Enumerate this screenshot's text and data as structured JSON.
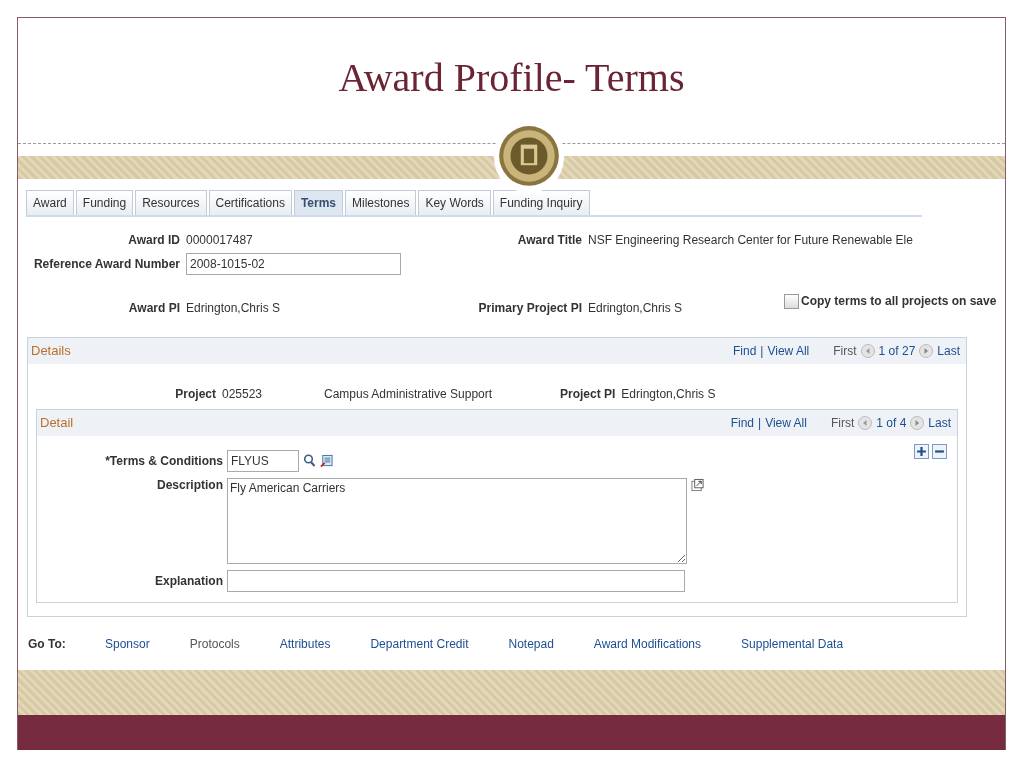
{
  "slide": {
    "title": "Award Profile- Terms"
  },
  "tabs": [
    {
      "label": "Award",
      "selected": false
    },
    {
      "label": "Funding",
      "selected": false
    },
    {
      "label": "Resources",
      "selected": false
    },
    {
      "label": "Certifications",
      "selected": false
    },
    {
      "label": "Terms",
      "selected": true
    },
    {
      "label": "Milestones",
      "selected": false
    },
    {
      "label": "Key Words",
      "selected": false
    },
    {
      "label": "Funding Inquiry",
      "selected": false
    }
  ],
  "award": {
    "award_id_label": "Award ID",
    "award_id": "0000017487",
    "award_title_label": "Award Title",
    "award_title": "NSF Engineering Research Center for Future Renewable Ele",
    "reference_label": "Reference Award Number",
    "reference_value": "2008-1015-02",
    "award_pi_label": "Award PI",
    "award_pi": "Edrington,Chris S",
    "primary_pi_label": "Primary Project PI",
    "primary_pi": "Edrington,Chris S",
    "copy_terms": {
      "label": "Copy terms to all projects on save",
      "checked": false
    }
  },
  "details": {
    "title": "Details",
    "find": "Find",
    "separator": "|",
    "view_all": "View All",
    "first": "First",
    "count": "1 of 27",
    "last": "Last",
    "project_label": "Project",
    "project_id": "025523",
    "project_name": "Campus Administrative Support",
    "project_pi_label": "Project PI",
    "project_pi": "Edrington,Chris S",
    "detail": {
      "title": "Detail",
      "find": "Find",
      "separator": "|",
      "view_all": "View All",
      "first": "First",
      "count": "1 of 4",
      "last": "Last",
      "terms_label": "*Terms & Conditions",
      "terms_value": "FLYUS",
      "description_label": "Description",
      "description_value": "Fly American Carriers",
      "explanation_label": "Explanation"
    }
  },
  "goto": {
    "label": "Go To:",
    "links": [
      {
        "label": "Sponsor",
        "disabled": false
      },
      {
        "label": "Protocols",
        "disabled": true
      },
      {
        "label": "Attributes",
        "disabled": false
      },
      {
        "label": "Department Credit",
        "disabled": false
      },
      {
        "label": "Notepad",
        "disabled": false
      },
      {
        "label": "Award Modifications",
        "disabled": false
      },
      {
        "label": "Supplemental Data",
        "disabled": false
      }
    ]
  }
}
